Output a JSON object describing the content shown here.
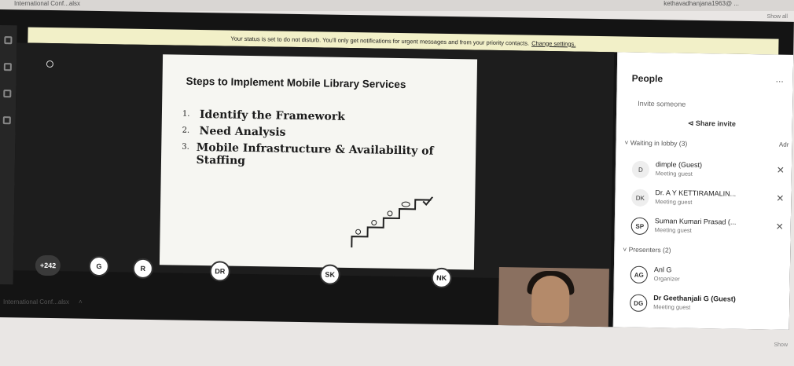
{
  "top": {
    "tab": "International Conf...alsx",
    "user": "kethavadhanjana1963@ ...",
    "show_all": "Show all"
  },
  "notification": {
    "text": "Your status is set to do not disturb. You'll only get notifications for urgent messages and from your priority contacts.",
    "link": "Change settings."
  },
  "slide": {
    "title": "Steps to Implement Mobile Library Services",
    "items": [
      {
        "num": "1.",
        "text": "Identify the Framework"
      },
      {
        "num": "2.",
        "text": "Need Analysis"
      },
      {
        "num": "3.",
        "text": "Mobile Infrastructure & Availability of Staffing"
      }
    ]
  },
  "participants": [
    {
      "label": "+242"
    },
    {
      "label": "G"
    },
    {
      "label": "R"
    },
    {
      "label": "DR"
    },
    {
      "label": "SK"
    },
    {
      "label": "NK"
    }
  ],
  "people_panel": {
    "title": "People",
    "more": "...",
    "invite_placeholder": "Invite someone",
    "share_invite": "Share invite",
    "lobby_header": "Waiting in lobby (3)",
    "lobby_action": "Adr",
    "lobby": [
      {
        "initials": "D",
        "name": "dimple (Guest)",
        "role": "Meeting guest"
      },
      {
        "initials": "DK",
        "name": "Dr. A Y KETTIRAMALIN...",
        "role": "Meeting guest"
      },
      {
        "initials": "SP",
        "name": "Suman Kumari Prasad (...",
        "role": "Meeting guest"
      }
    ],
    "presenters_header": "Presenters (2)",
    "presenters": [
      {
        "initials": "AG",
        "name": "Anl G",
        "role": "Organizer"
      },
      {
        "initials": "DG",
        "name": "Dr Geethanjali G (Guest)",
        "role": "Meeting guest"
      }
    ]
  },
  "downloads": {
    "item": "International Conf...alsx",
    "show_all": "Show"
  }
}
